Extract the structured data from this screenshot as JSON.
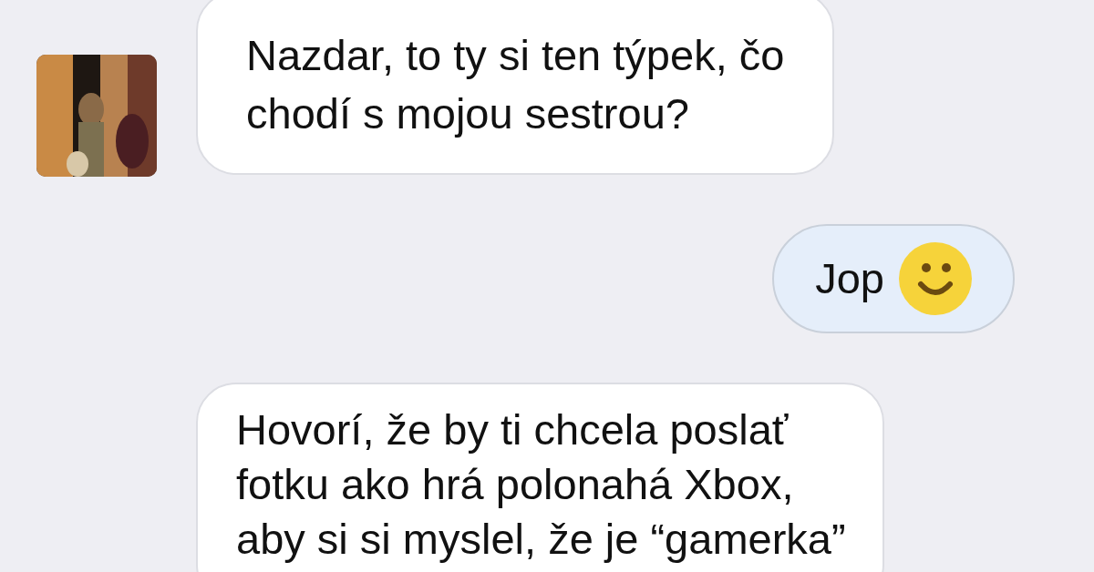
{
  "messages": [
    {
      "kind": "incoming",
      "text": "Nazdar, to ty si ten týpek, čo\nchodí s mojou sestrou?"
    },
    {
      "kind": "outgoing",
      "text": "Jop",
      "emoji": {
        "kind": "smile"
      }
    },
    {
      "kind": "incoming",
      "text": "Hovorí, že by ti chcela poslať\nfotku ako hrá polonahá Xbox,\naby si si myslel, že je “gamerka”"
    }
  ]
}
